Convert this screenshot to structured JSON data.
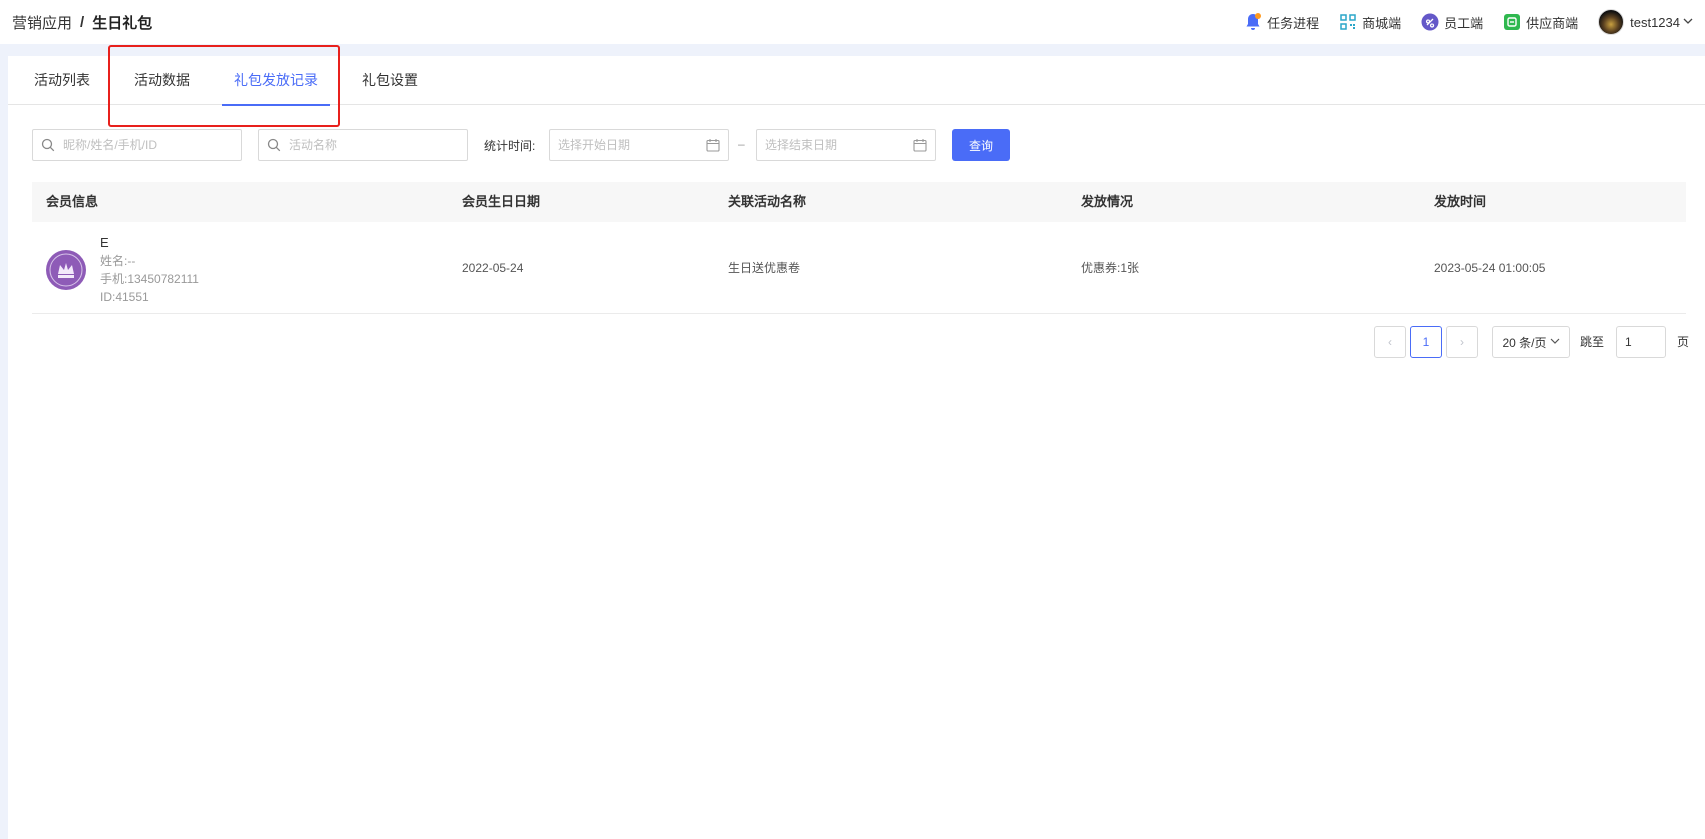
{
  "breadcrumb": {
    "parent": "营销应用",
    "separator": "/",
    "current": "生日礼包"
  },
  "topnav": {
    "task": "任务进程",
    "mall": "商城端",
    "staff": "员工端",
    "supplier": "供应商端",
    "user": "test1234"
  },
  "tabs": [
    "活动列表",
    "活动数据",
    "礼包发放记录",
    "礼包设置"
  ],
  "active_tab": "礼包发放记录",
  "filters": {
    "member_placeholder": "昵称/姓名/手机/ID",
    "activity_placeholder": "活动名称",
    "time_label": "统计时间:",
    "start_placeholder": "选择开始日期",
    "dash": "–",
    "end_placeholder": "选择结束日期",
    "query_label": "查询"
  },
  "table": {
    "columns": [
      "会员信息",
      "会员生日日期",
      "关联活动名称",
      "发放情况",
      "发放时间"
    ],
    "rows": [
      {
        "nickname": "E",
        "name": "姓名:--",
        "phone": "手机:13450782111",
        "id": "ID:41551",
        "birthday": "2022-05-24",
        "activity": "生日送优惠卷",
        "status": "优惠券:1张",
        "time": "2023-05-24 01:00:05"
      }
    ]
  },
  "pagination": {
    "prev": "‹",
    "page": "1",
    "next": "›",
    "page_size": "20 条/页",
    "jump_label": "跳至",
    "jump_value": "1",
    "page_unit": "页"
  },
  "colors": {
    "accent": "#4a6cf7",
    "highlight_box": "#e8201c"
  }
}
